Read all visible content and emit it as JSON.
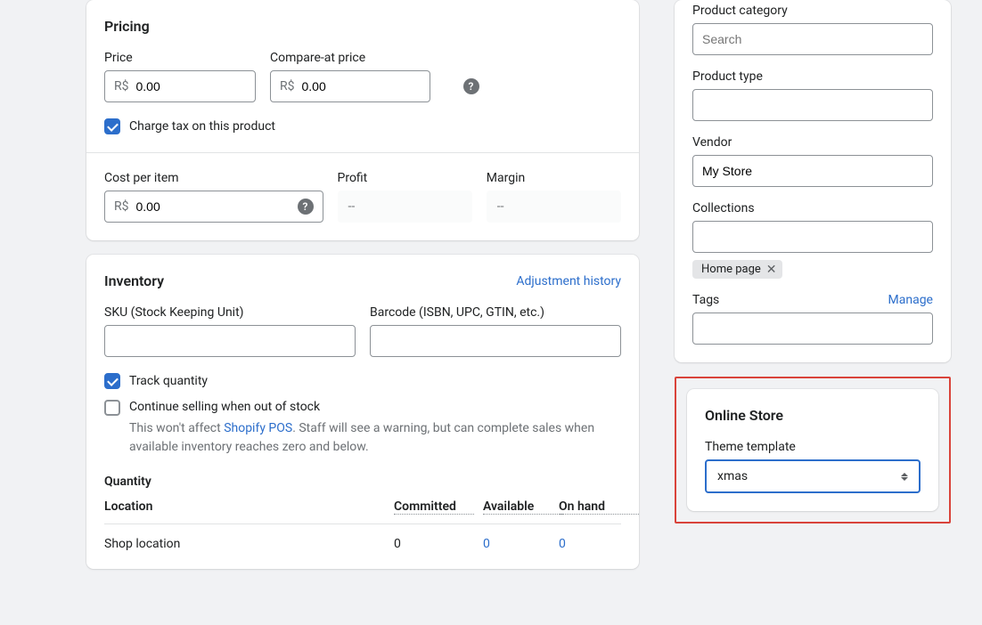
{
  "pricing": {
    "title": "Pricing",
    "price_label": "Price",
    "compare_label": "Compare-at price",
    "currency": "R$",
    "price_value": "0.00",
    "compare_value": "0.00",
    "tax_label": "Charge tax on this product",
    "cost_label": "Cost per item",
    "cost_value": "0.00",
    "profit_label": "Profit",
    "profit_value": "--",
    "margin_label": "Margin",
    "margin_value": "--"
  },
  "inventory": {
    "title": "Inventory",
    "history_link": "Adjustment history",
    "sku_label": "SKU (Stock Keeping Unit)",
    "barcode_label": "Barcode (ISBN, UPC, GTIN, etc.)",
    "track_label": "Track quantity",
    "continue_label": "Continue selling when out of stock",
    "note_prefix": "This won't affect ",
    "note_link": "Shopify POS",
    "note_suffix": ". Staff will see a warning, but can complete sales when available inventory reaches zero and below.",
    "quantity_title": "Quantity",
    "location_header": "Location",
    "committed_header": "Committed",
    "available_header": "Available",
    "onhand_header": "On hand",
    "location_name": "Shop location",
    "committed_value": "0",
    "available_value": "0",
    "onhand_value": "0"
  },
  "organization": {
    "category_label": "Product category",
    "search_placeholder": "Search",
    "type_label": "Product type",
    "vendor_label": "Vendor",
    "vendor_value": "My Store",
    "collections_label": "Collections",
    "collection_tag": "Home page",
    "tags_label": "Tags",
    "manage_link": "Manage"
  },
  "online_store": {
    "title": "Online Store",
    "template_label": "Theme template",
    "template_value": "xmas"
  }
}
